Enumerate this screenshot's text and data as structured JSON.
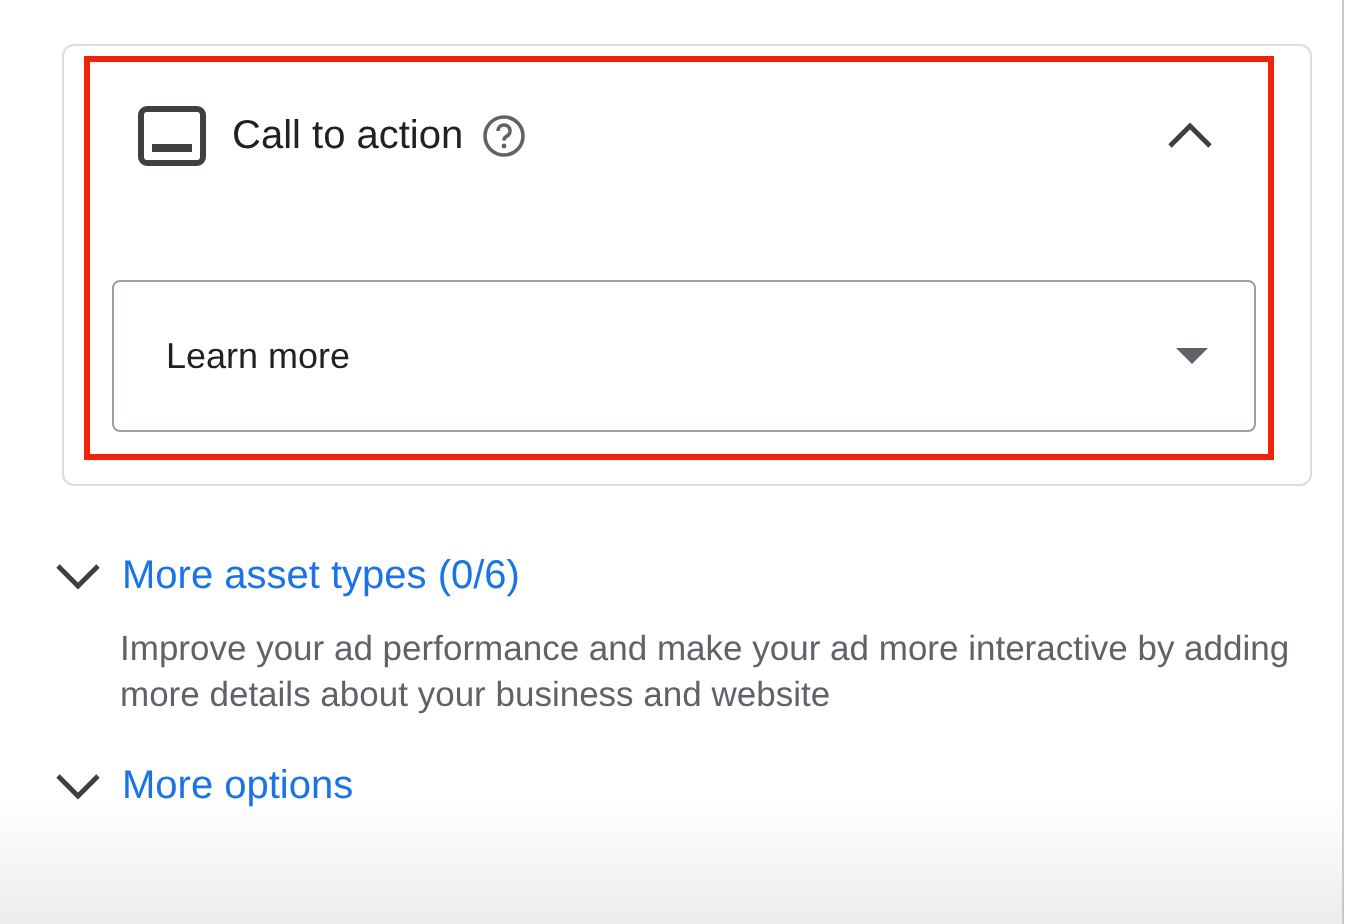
{
  "card": {
    "title": "Call to action",
    "expanded": true,
    "dropdown": {
      "value": "Learn more"
    }
  },
  "sections": [
    {
      "label": "More asset types (0/6)",
      "expanded": false,
      "description": "Improve your ad performance and make your ad more interactive by adding more details about your business and website"
    },
    {
      "label": "More options",
      "expanded": false
    }
  ]
}
